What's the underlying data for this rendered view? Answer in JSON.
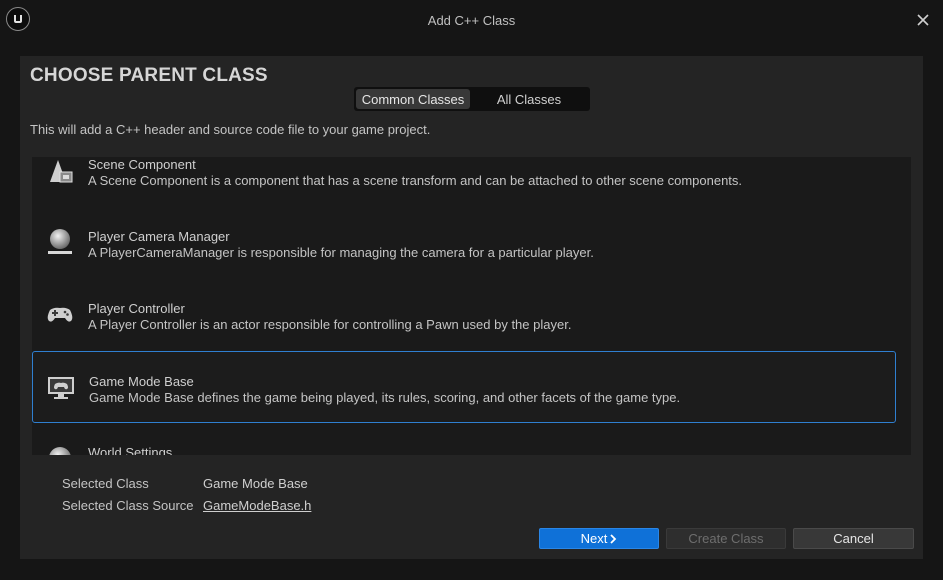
{
  "window": {
    "title": "Add C++ Class"
  },
  "header": {
    "title": "CHOOSE PARENT CLASS",
    "tabs": [
      {
        "label": "Common Classes",
        "active": true
      },
      {
        "label": "All Classes",
        "active": false
      }
    ],
    "description": "This will add a C++ header and source code file to your game project."
  },
  "class_list": [
    {
      "name": "Scene Component",
      "description": "A Scene Component is a component that has a scene transform and can be attached to other scene components.",
      "icon": "scene-component-icon"
    },
    {
      "name": "Player Camera Manager",
      "description": "A PlayerCameraManager is responsible for managing the camera for a particular player.",
      "icon": "camera-sphere-icon"
    },
    {
      "name": "Player Controller",
      "description": "A Player Controller is an actor responsible for controlling a Pawn used by the player.",
      "icon": "gamepad-icon"
    },
    {
      "name": "Game Mode Base",
      "description": "Game Mode Base defines the game being played, its rules, scoring, and other facets of the game type.",
      "icon": "monitor-gamepad-icon",
      "selected": true
    },
    {
      "name": "World Settings",
      "description": "",
      "icon": "world-sphere-icon"
    }
  ],
  "selection": {
    "class_label": "Selected Class",
    "class_value": "Game Mode Base",
    "source_label": "Selected Class Source",
    "source_value": "GameModeBase.h"
  },
  "buttons": {
    "next": "Next",
    "create": "Create Class",
    "cancel": "Cancel"
  },
  "colors": {
    "accent": "#0f71d8",
    "selection_border": "#2f7fd0",
    "panel_bg": "#242424",
    "window_bg": "#151515"
  }
}
